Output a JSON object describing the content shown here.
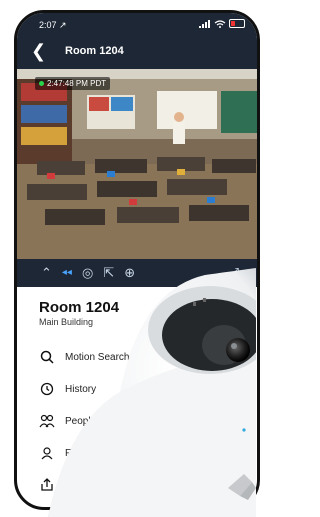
{
  "status_bar": {
    "time": "2:07 ↗",
    "icons": [
      "cellular-signal-icon",
      "wifi-icon",
      "battery-icon"
    ]
  },
  "nav": {
    "title": "Room 1204",
    "back_icon": "chevron-left-icon"
  },
  "video": {
    "timestamp": "2:47:48 PM PDT",
    "live_indicator_color": "#27d34d"
  },
  "controls": {
    "items": [
      {
        "name": "chevron-up-icon"
      },
      {
        "name": "live-icon",
        "label": "◂◂"
      },
      {
        "name": "snapshot-icon"
      },
      {
        "name": "share-icon"
      },
      {
        "name": "zoom-icon"
      },
      {
        "name": "fullscreen-icon"
      }
    ],
    "accent": "#4aa3ff"
  },
  "camera": {
    "name": "Room 1204",
    "location": "Main Building"
  },
  "menu": {
    "items": [
      {
        "label": "Motion Search",
        "icon": "search-icon"
      },
      {
        "label": "History",
        "icon": "history-icon"
      },
      {
        "label": "People",
        "icon": "people-icon"
      },
      {
        "label": "Fac",
        "icon": "face-icon"
      },
      {
        "label": "",
        "icon": "export-icon"
      },
      {
        "label": "",
        "icon": "settings-icon"
      }
    ]
  },
  "colors": {
    "header": "#1d2735",
    "background": "#ffffff"
  }
}
